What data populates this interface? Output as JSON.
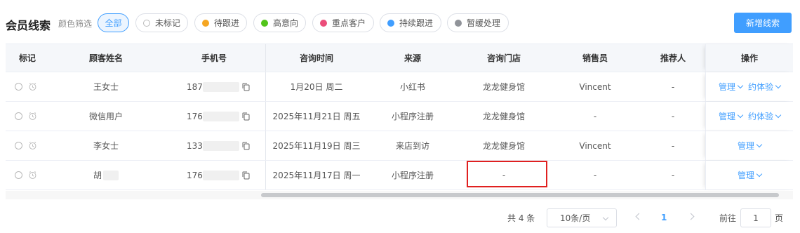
{
  "header": {
    "title": "会员线索",
    "filter_label": "颜色筛选",
    "chips": [
      {
        "label": "全部",
        "active": true
      },
      {
        "label": "未标记",
        "color": "hollow"
      },
      {
        "label": "待跟进",
        "color": "#f5a623"
      },
      {
        "label": "高意向",
        "color": "#52c41a"
      },
      {
        "label": "重点客户",
        "color": "#eb4d7a"
      },
      {
        "label": "持续跟进",
        "color": "#409eff"
      },
      {
        "label": "暂缓处理",
        "color": "#909399"
      }
    ],
    "add_button": "新增线索"
  },
  "table": {
    "columns": [
      "标记",
      "顾客姓名",
      "手机号",
      "咨询时间",
      "来源",
      "咨询门店",
      "销售员",
      "推荐人",
      "操作"
    ],
    "rows": [
      {
        "name": "王女士",
        "phone": "187",
        "time": "1月20日 周二",
        "source": "小红书",
        "store": "龙龙健身馆",
        "sales": "Vincent",
        "referrer": "-",
        "ops": [
          "管理",
          "约体验"
        ]
      },
      {
        "name": "微信用户",
        "phone": "176",
        "time": "2025年11月21日 周五",
        "source": "小程序注册",
        "store": "龙龙健身馆",
        "sales": "-",
        "referrer": "-",
        "ops": [
          "管理",
          "约体验"
        ]
      },
      {
        "name": "李女士",
        "phone": "133",
        "time": "2025年11月19日 周三",
        "source": "来店到访",
        "store": "龙龙健身馆",
        "sales": "Vincent",
        "referrer": "-",
        "ops": [
          "管理"
        ]
      },
      {
        "name": "胡",
        "phone": "176",
        "time": "2025年11月17日 周一",
        "source": "小程序注册",
        "store": "-",
        "sales": "-",
        "referrer": "-",
        "ops": [
          "管理"
        ]
      }
    ]
  },
  "pagination": {
    "total": "共 4 条",
    "page_size": "10条/页",
    "current_page": "1",
    "goto_label": "前往",
    "goto_value": "1",
    "page_suffix": "页"
  },
  "colors": {
    "accent": "#409eff",
    "highlight": "#e02020"
  }
}
